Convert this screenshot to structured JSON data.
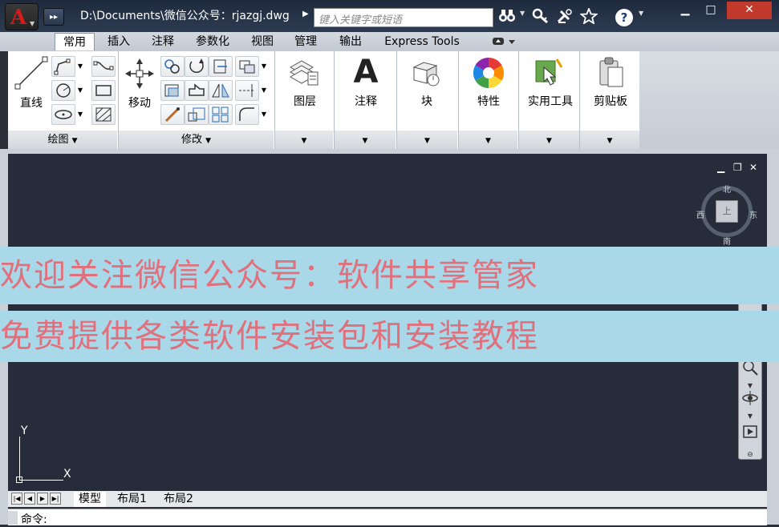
{
  "titlebar": {
    "path": "D:\\Documents\\微信公众号：rjazgj.dwg",
    "search_placeholder": "键入关键字或短语",
    "icons": [
      "binoculars-icon",
      "key-icon",
      "satellite-icon",
      "star-icon",
      "help-icon"
    ],
    "help_label": "?"
  },
  "window": {
    "minimize": "▁",
    "maximize": "□",
    "close": "✕"
  },
  "tabs": [
    "常用",
    "插入",
    "注释",
    "参数化",
    "视图",
    "管理",
    "输出",
    "Express Tools"
  ],
  "ribbon": {
    "draw": {
      "line_label": "直线",
      "panel_label": "绘图"
    },
    "modify": {
      "move_label": "移动",
      "panel_label": "修改"
    },
    "big_buttons": [
      {
        "label": "图层",
        "icon": "layers-icon"
      },
      {
        "label": "注释",
        "icon": "text-a-icon"
      },
      {
        "label": "块",
        "icon": "block-icon"
      },
      {
        "label": "特性",
        "icon": "color-wheel-icon"
      },
      {
        "label": "实用工具",
        "icon": "utilities-icon"
      },
      {
        "label": "剪贴板",
        "icon": "clipboard-icon"
      }
    ]
  },
  "viewcube": {
    "north": "北",
    "south": "南",
    "east": "东",
    "west": "西",
    "face": "上"
  },
  "banner": {
    "line1": "欢迎关注微信公众号：软件共享管家",
    "line2": "免费提供各类软件安装包和安装教程"
  },
  "ucs": {
    "x": "X",
    "y": "Y"
  },
  "layout_tabs": [
    "模型",
    "布局1",
    "布局2"
  ],
  "command": {
    "prompt": "命令:"
  },
  "colors": {
    "accent_red": "#d21b1b",
    "banner_bg": "#a9d8e8",
    "banner_text": "#e0707c",
    "canvas": "#262c39"
  }
}
